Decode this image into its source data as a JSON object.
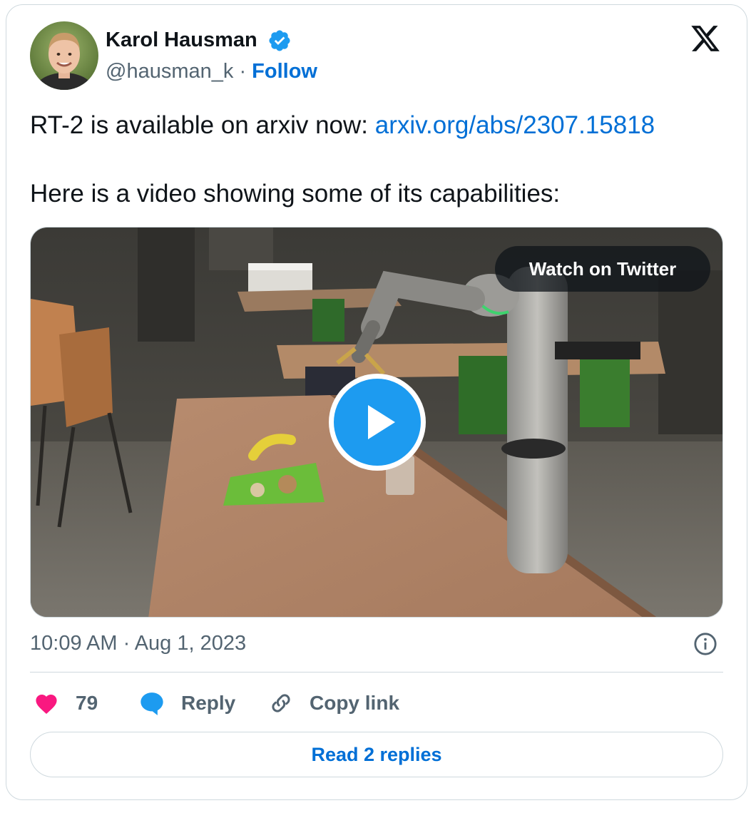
{
  "tweet": {
    "author": {
      "name": "Karol Hausman",
      "handle": "@hausman_k",
      "separator": "·",
      "follow_label": "Follow",
      "verified": true
    },
    "text_line1_prefix": "RT-2 is available on arxiv now: ",
    "link_text": "arxiv.org/abs/2307.15818",
    "text_line2": "Here is a video showing some of its capabilities:",
    "media": {
      "watch_label": "Watch on Twitter",
      "play_icon": "play-icon"
    },
    "timestamp": "10:09 AM · Aug 1, 2023",
    "actions": {
      "like_count": "79",
      "reply_label": "Reply",
      "copy_label": "Copy link"
    },
    "read_replies_label": "Read 2 replies"
  },
  "colors": {
    "link": "#006fd6",
    "secondary_text": "#536471",
    "like": "#f91880",
    "reply_icon": "#1d9bf0",
    "border": "#cfd9de"
  },
  "icons": [
    "verified-badge-icon",
    "x-logo-icon",
    "info-icon",
    "heart-icon",
    "reply-bubble-icon",
    "link-icon",
    "play-icon"
  ]
}
